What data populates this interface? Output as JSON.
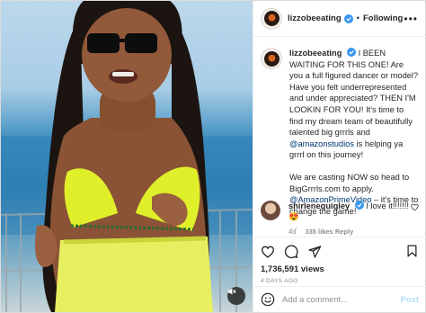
{
  "header": {
    "username": "lizzobeeating",
    "separator": "•",
    "follow_label": "Following",
    "more_icon": "more-horizontal-icon"
  },
  "caption": {
    "username": "lizzobeeating",
    "p1_part1": "I BEEN WAITING FOR THIS ONE! Are you a full figured dancer or model? Have you felt underrepresented and under appreciated? THEN I'M LOOKIN FOR YOU! It's time to find my dream team of beautifully talented big grrrls and ",
    "p1_mention": "@amazonstudios",
    "p1_part2": " is helping ya grrrl on this journey!",
    "p2_part1": "We are casting NOW so head to BigGrrrls.com to apply. ",
    "p2_mention": "@AmazonPrimeVideo",
    "p2_part2": " – it's time to change the game!",
    "time": "4d"
  },
  "comment": {
    "username": "shirlenequigley",
    "text": "I love it!!!!!!! 😍",
    "time": "4d",
    "likes": "335 likes",
    "reply_label": "Reply"
  },
  "actions": {
    "views": "1,736,591 views",
    "posted_ago": "4 DAYS AGO"
  },
  "add_comment": {
    "placeholder": "Add a comment...",
    "post_label": "Post"
  },
  "colors": {
    "verified_blue": "#3897f0",
    "link_blue": "#00376b",
    "post_disabled": "#b2dffc",
    "muted_gray": "#8e8e8e"
  }
}
